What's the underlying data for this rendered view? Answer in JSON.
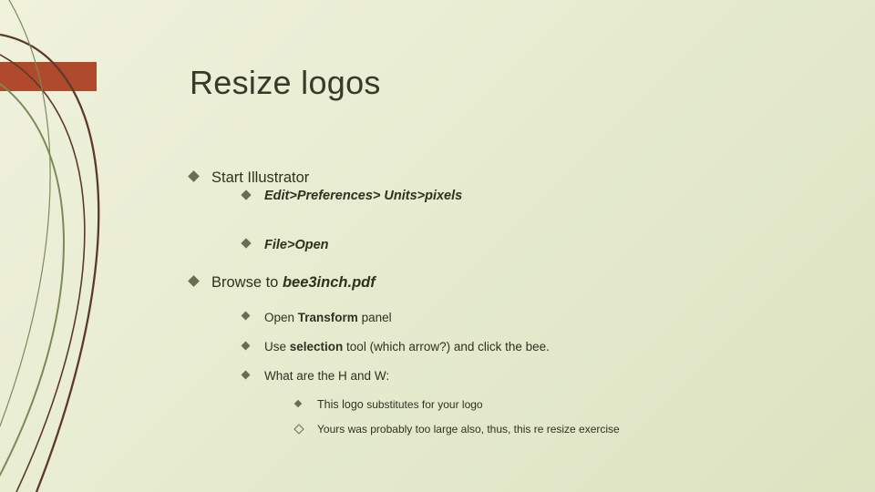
{
  "title": "Resize logos",
  "l1_start": "Start Illustrator",
  "l2_prefs": "Edit>Preferences> Units>pixels",
  "l2_fileopen": "File>Open",
  "l1_browse_pre": "Browse to ",
  "l1_browse_em": "bee3inch.pdf",
  "l3_open_pre": "Open ",
  "l3_open_bold": "Transform",
  "l3_open_post": " panel",
  "l3_sel_pre": "Use ",
  "l3_sel_bold": "selection",
  "l3_sel_post": " tool  (which arrow?) and click the bee.",
  "l3_hw": "What are the H and W:",
  "l4_sub_pre": "This  logo ",
  "l4_sub_post": "substitutes for your logo",
  "l4_yours": "Yours was probably too large also, thus, this  re resize exercise"
}
